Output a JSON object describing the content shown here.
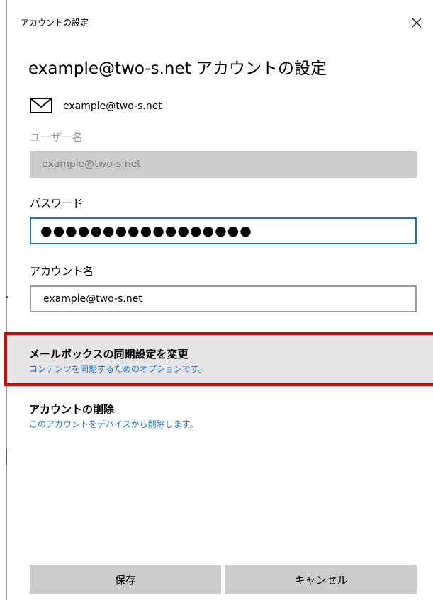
{
  "window": {
    "title": "アカウントの設定",
    "close_icon": "close-icon"
  },
  "header": {
    "heading": "example@two-s.net アカウントの設定",
    "mail_icon": "mail-icon",
    "email": "example@two-s.net"
  },
  "fields": {
    "username": {
      "label": "ユーザー名",
      "value": "example@two-s.net",
      "disabled": true
    },
    "password": {
      "label": "パスワード",
      "value": "●●●●●●●●●●●●●●●●●"
    },
    "account_name": {
      "label": "アカウント名",
      "value": "example@two-s.net"
    }
  },
  "actions": {
    "sync": {
      "title": "メールボックスの同期設定を変更",
      "description": "コンテンツを同期するためのオプションです。"
    },
    "delete": {
      "title": "アカウントの削除",
      "description": "このアカウントをデバイスから削除します。"
    }
  },
  "buttons": {
    "save": "保存",
    "cancel": "キャンセル"
  },
  "colors": {
    "accent": "#1a73c9",
    "highlight": "#e00000",
    "selected_row_bg": "#e6e6e6",
    "button_bg": "#cccccc"
  }
}
